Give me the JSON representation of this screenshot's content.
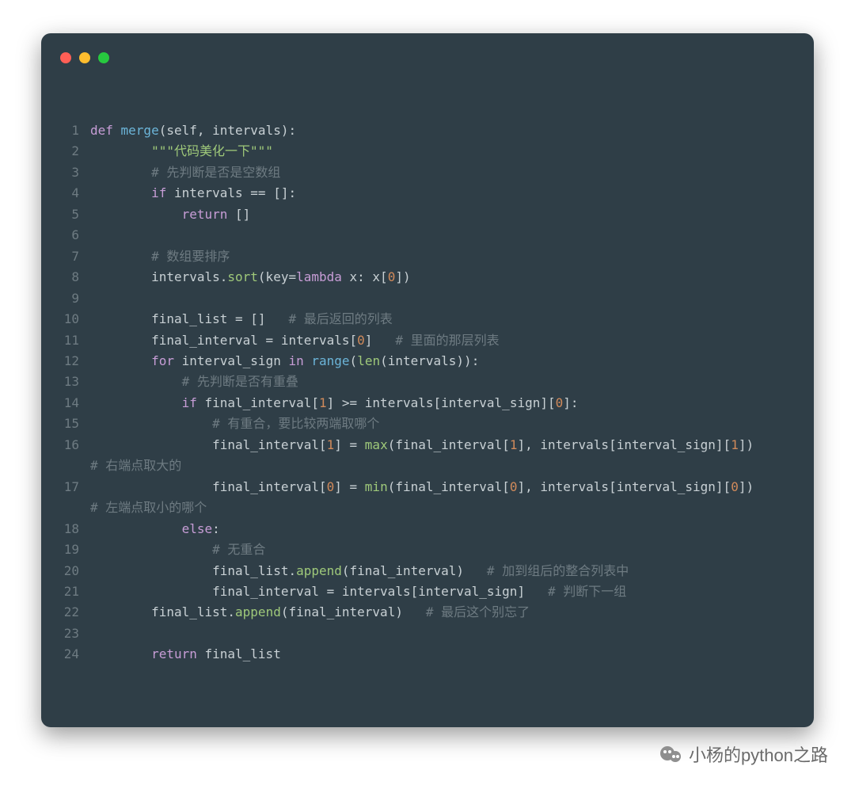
{
  "window": {
    "traffic_colors": [
      "#ff5f56",
      "#ffbd2e",
      "#27c93f"
    ]
  },
  "watermark": {
    "text": "小杨的python之路"
  },
  "code": {
    "lines": [
      {
        "n": "1",
        "tokens": [
          [
            "kw",
            "def "
          ],
          [
            "fn",
            "merge"
          ],
          [
            "txt",
            "(self, intervals):"
          ]
        ]
      },
      {
        "n": "2",
        "tokens": [
          [
            "txt",
            "        "
          ],
          [
            "str",
            "\"\"\"代码美化一下\"\"\""
          ]
        ]
      },
      {
        "n": "3",
        "tokens": [
          [
            "txt",
            "        "
          ],
          [
            "cmt",
            "# 先判断是否是空数组"
          ]
        ]
      },
      {
        "n": "4",
        "tokens": [
          [
            "txt",
            "        "
          ],
          [
            "kw",
            "if"
          ],
          [
            "txt",
            " intervals == []:"
          ]
        ]
      },
      {
        "n": "5",
        "tokens": [
          [
            "txt",
            "            "
          ],
          [
            "kw",
            "return"
          ],
          [
            "txt",
            " []"
          ]
        ]
      },
      {
        "n": "6",
        "tokens": [
          [
            "txt",
            ""
          ]
        ]
      },
      {
        "n": "7",
        "tokens": [
          [
            "txt",
            "        "
          ],
          [
            "cmt",
            "# 数组要排序"
          ]
        ]
      },
      {
        "n": "8",
        "tokens": [
          [
            "txt",
            "        intervals."
          ],
          [
            "fnG",
            "sort"
          ],
          [
            "txt",
            "(key="
          ],
          [
            "kw",
            "lambda"
          ],
          [
            "txt",
            " x: x["
          ],
          [
            "num",
            "0"
          ],
          [
            "txt",
            "])"
          ]
        ]
      },
      {
        "n": "9",
        "tokens": [
          [
            "txt",
            ""
          ]
        ]
      },
      {
        "n": "10",
        "tokens": [
          [
            "txt",
            "        final_list = []   "
          ],
          [
            "cmt",
            "# 最后返回的列表"
          ]
        ]
      },
      {
        "n": "11",
        "tokens": [
          [
            "txt",
            "        final_interval = intervals["
          ],
          [
            "num",
            "0"
          ],
          [
            "txt",
            "]   "
          ],
          [
            "cmt",
            "# 里面的那层列表"
          ]
        ]
      },
      {
        "n": "12",
        "tokens": [
          [
            "txt",
            "        "
          ],
          [
            "kw",
            "for"
          ],
          [
            "txt",
            " interval_sign "
          ],
          [
            "kw",
            "in"
          ],
          [
            "txt",
            " "
          ],
          [
            "fn",
            "range"
          ],
          [
            "txt",
            "("
          ],
          [
            "fnG",
            "len"
          ],
          [
            "txt",
            "(intervals)):"
          ]
        ]
      },
      {
        "n": "13",
        "tokens": [
          [
            "txt",
            "            "
          ],
          [
            "cmt",
            "# 先判断是否有重叠"
          ]
        ]
      },
      {
        "n": "14",
        "tokens": [
          [
            "txt",
            "            "
          ],
          [
            "kw",
            "if"
          ],
          [
            "txt",
            " final_interval["
          ],
          [
            "num",
            "1"
          ],
          [
            "txt",
            "] >= intervals[interval_sign]["
          ],
          [
            "num",
            "0"
          ],
          [
            "txt",
            "]:"
          ]
        ]
      },
      {
        "n": "15",
        "tokens": [
          [
            "txt",
            "                "
          ],
          [
            "cmt",
            "# 有重合，要比较两端取哪个"
          ]
        ]
      },
      {
        "n": "16",
        "tokens": [
          [
            "txt",
            "                final_interval["
          ],
          [
            "num",
            "1"
          ],
          [
            "txt",
            "] = "
          ],
          [
            "fnG",
            "max"
          ],
          [
            "txt",
            "(final_interval["
          ],
          [
            "num",
            "1"
          ],
          [
            "txt",
            "], intervals[interval_sign]["
          ],
          [
            "num",
            "1"
          ],
          [
            "txt",
            "])  "
          ]
        ],
        "wrap": [
          [
            "cmt",
            "# 右端点取大的"
          ]
        ]
      },
      {
        "n": "17",
        "tokens": [
          [
            "txt",
            "                final_interval["
          ],
          [
            "num",
            "0"
          ],
          [
            "txt",
            "] = "
          ],
          [
            "fnG",
            "min"
          ],
          [
            "txt",
            "(final_interval["
          ],
          [
            "num",
            "0"
          ],
          [
            "txt",
            "], intervals[interval_sign]["
          ],
          [
            "num",
            "0"
          ],
          [
            "txt",
            "])  "
          ]
        ],
        "wrap": [
          [
            "cmt",
            "# 左端点取小的哪个"
          ]
        ]
      },
      {
        "n": "18",
        "tokens": [
          [
            "txt",
            "            "
          ],
          [
            "kw",
            "else"
          ],
          [
            "txt",
            ":"
          ]
        ]
      },
      {
        "n": "19",
        "tokens": [
          [
            "txt",
            "                "
          ],
          [
            "cmt",
            "# 无重合"
          ]
        ]
      },
      {
        "n": "20",
        "tokens": [
          [
            "txt",
            "                final_list."
          ],
          [
            "fnG",
            "append"
          ],
          [
            "txt",
            "(final_interval)   "
          ],
          [
            "cmt",
            "# 加到组后的整合列表中"
          ]
        ]
      },
      {
        "n": "21",
        "tokens": [
          [
            "txt",
            "                final_interval = intervals[interval_sign]   "
          ],
          [
            "cmt",
            "# 判断下一组"
          ]
        ]
      },
      {
        "n": "22",
        "tokens": [
          [
            "txt",
            "        final_list."
          ],
          [
            "fnG",
            "append"
          ],
          [
            "txt",
            "(final_interval)   "
          ],
          [
            "cmt",
            "# 最后这个别忘了"
          ]
        ]
      },
      {
        "n": "23",
        "tokens": [
          [
            "txt",
            ""
          ]
        ]
      },
      {
        "n": "24",
        "tokens": [
          [
            "txt",
            "        "
          ],
          [
            "kw",
            "return"
          ],
          [
            "txt",
            " final_list"
          ]
        ]
      }
    ]
  }
}
